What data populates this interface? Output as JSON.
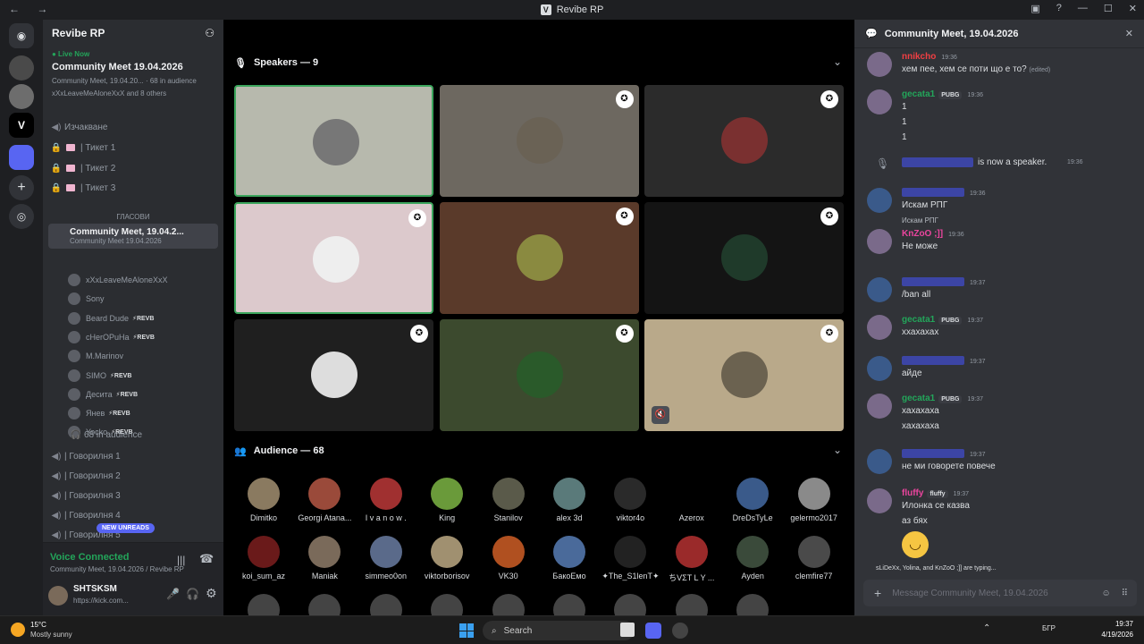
{
  "window": {
    "title": "Revibe RP",
    "nav": "← →"
  },
  "colors": {
    "bg": "#1e1f22",
    "sidebar": "#2b2d31",
    "chat": "#313338",
    "green": "#23a55a",
    "accent": "#5865f2"
  },
  "server": {
    "name": "Revibe RP"
  },
  "live": {
    "badge": "● Live Now",
    "title": "Community Meet 19.04.2026",
    "sub": "Community Meet, 19.04.20...",
    "audience": "68 in audience",
    "others": "xXxLeaveMeAloneXxX and 8 others"
  },
  "channels": {
    "waiting": "Изчакване",
    "t1": "Тикет 1",
    "t2": "Тикет 2",
    "t3": "Тикет 3",
    "category": "ГЛАСОВИ",
    "stage": "Community Meet, 19.04.2...",
    "stage_sub": "Community Meet 19.04.2026",
    "g1": "Говорилня 1",
    "g2": "Говорилня 2",
    "g3": "Говорилня 3",
    "g4": "Говорилня 4",
    "g5": "Говорилня 5",
    "new_unreads": "NEW UNREADS"
  },
  "stage_users": [
    {
      "name": "xXxLeaveMeAloneXxX",
      "tag": ""
    },
    {
      "name": "Sony",
      "tag": ""
    },
    {
      "name": "Beard Dude",
      "tag": "⚡REVB"
    },
    {
      "name": "cHerOPuHa",
      "tag": "⚡REVB"
    },
    {
      "name": "M.Marinov",
      "tag": ""
    },
    {
      "name": "SIMO",
      "tag": "⚡REVB"
    },
    {
      "name": "Десита",
      "tag": "⚡REVB"
    },
    {
      "name": "Янев",
      "tag": "⚡REVB"
    },
    {
      "name": "Yocko",
      "tag": "⚡REVB"
    }
  ],
  "in_audience": "68 in audience",
  "voice": {
    "status": "Voice Connected",
    "sub": "Community Meet, 19.04.2026 / Revibe RP",
    "user": "SHTSKSM",
    "user_status": "https://kick.com..."
  },
  "speakers_label": "Speakers — 9",
  "audience_label": "Audience — 68",
  "audience": [
    "Dimitko",
    "Georgi Atana...",
    "I v a n o w .",
    "King",
    "Stanilov",
    "alex 3d",
    "viktor4o",
    "Azerox",
    "DreDsTyLe",
    "gelermo2017",
    "koi_sum_az",
    "Maniak",
    "simmeo0on",
    "viktorborisov",
    "VK30",
    "БакоЕмо",
    "✦The_S1lenT✦",
    "ちVΣT L Y ...",
    "Ayden",
    "clemfire77"
  ],
  "chat": {
    "title": "Community Meet, 19.04.2026",
    "typing": "sLiDeXx, Yolina, and KnZoO ;]] are typing...",
    "placeholder": "Message Community Meet, 19.04.2026",
    "messages": [
      {
        "name": "nnikcho",
        "time": "19:36",
        "text": "хем пее, хем се поти що е то?",
        "edited": "(edited)"
      },
      {
        "name": "gecata1",
        "pill": "PUBG",
        "time": "19:36",
        "lines": [
          "1",
          "1",
          "1"
        ]
      },
      {
        "system": "is now a speaker.",
        "time": "19:36"
      },
      {
        "time": "19:36",
        "text": "Искам РПГ"
      },
      {
        "name": "KnZoO ;]]",
        "time": "19:36",
        "reply": "Искам РПГ",
        "text": "Не може"
      },
      {
        "time": "19:37",
        "text": "/ban all"
      },
      {
        "name": "gecata1",
        "pill": "PUBG",
        "time": "19:37",
        "text": "ххахахах"
      },
      {
        "time": "19:37",
        "text": "айде"
      },
      {
        "name": "gecata1",
        "pill": "PUBG",
        "time": "19:37",
        "lines": [
          "хахахаха",
          "хахахаха"
        ]
      },
      {
        "time": "19:37",
        "text": "не ми говорете повече"
      },
      {
        "name": "fluffy",
        "pill": "fluffy",
        "time": "19:37",
        "lines": [
          "Илонка се казва",
          "аз бях"
        ]
      }
    ]
  },
  "taskbar": {
    "temp": "15°C",
    "weather": "Mostly sunny",
    "search": "Search",
    "lang": "БГР",
    "time": "19:37",
    "date": "4/19/2026"
  }
}
